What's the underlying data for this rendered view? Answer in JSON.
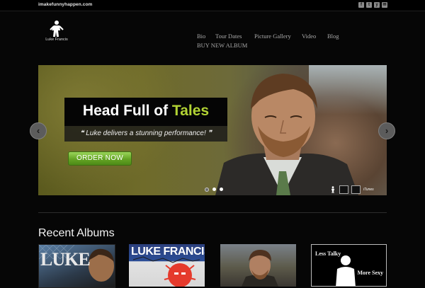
{
  "topbar": {
    "site_url": "imakefunnyhappen.com",
    "social_icons": [
      {
        "name": "facebook-icon",
        "glyph": "f"
      },
      {
        "name": "twitter-icon",
        "glyph": "t"
      },
      {
        "name": "youtube-icon",
        "glyph": "y"
      },
      {
        "name": "email-icon",
        "glyph": "✉"
      }
    ]
  },
  "logo": {
    "text": "Luke Francis",
    "icon": "standing-figure-icon"
  },
  "nav": {
    "items": [
      {
        "label": "Bio"
      },
      {
        "label": "Tour Dates"
      },
      {
        "label": "Picture Gallery"
      },
      {
        "label": "Video"
      },
      {
        "label": "Blog"
      },
      {
        "label": "BUY NEW ALBUM"
      }
    ]
  },
  "slider": {
    "headline_part1": "Head Full of ",
    "headline_part2": "Tales",
    "quote": "Luke delivers a stunning performance!",
    "quote_open": "❝",
    "quote_close": "❞",
    "order_button": "ORDER NOW",
    "prev_icon": "chevron-left-icon",
    "next_icon": "chevron-right-icon",
    "prev_glyph": "‹",
    "next_glyph": "›",
    "slide_count": 3,
    "active_slide": 1,
    "badge_itunes": "iTunes"
  },
  "recent_albums": {
    "title": "Recent Albums",
    "albums": [
      {
        "title": "LUKE"
      },
      {
        "title": "LUKE FRANCIS"
      },
      {
        "title": ""
      },
      {
        "line1": "Less Talky",
        "line2": "More Sexy"
      }
    ]
  },
  "colors": {
    "accent_green": "#b2d334",
    "button_green": "#64a424",
    "background": "#060606"
  }
}
